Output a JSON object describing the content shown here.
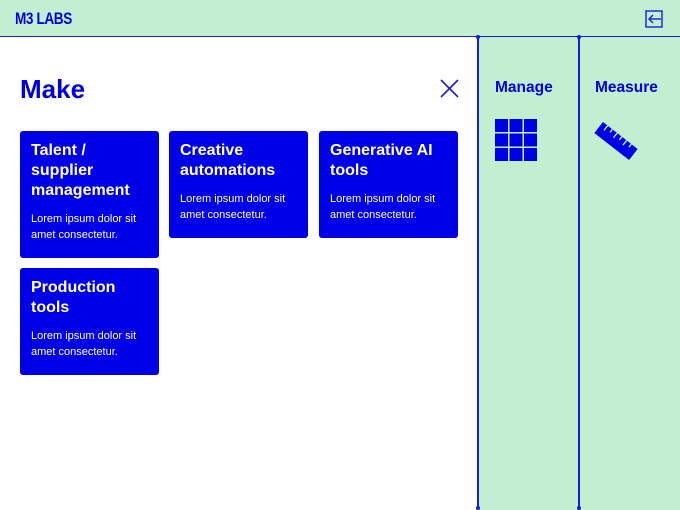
{
  "header": {
    "logo_text": "M3 LABS",
    "exit_icon": "exit-icon"
  },
  "make_panel": {
    "title": "Make",
    "close_icon": "close-icon",
    "cards": [
      {
        "title": "Talent / supplier management",
        "description": "Lorem ipsum dolor sit amet consectetur."
      },
      {
        "title": "Creative automations",
        "description": "Lorem ipsum dolor sit amet consectetur."
      },
      {
        "title": "Generative AI tools",
        "description": "Lorem ipsum dolor sit amet consectetur."
      },
      {
        "title": "Production tools",
        "description": "Lorem ipsum dolor sit amet consectetur."
      }
    ]
  },
  "side_nav": [
    {
      "label": "Manage",
      "icon": "grid-icon"
    },
    {
      "label": "Measure",
      "icon": "ruler-icon"
    }
  ],
  "colors": {
    "accent": "#0000e6",
    "background": "#c2efd0",
    "panel": "#ffffff"
  }
}
